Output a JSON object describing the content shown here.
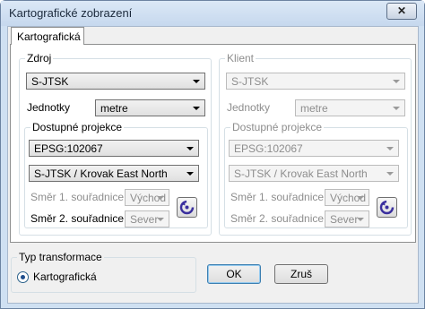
{
  "window": {
    "title": "Kartografické zobrazení",
    "close_glyph": "✕"
  },
  "tab": {
    "label": "Kartografická"
  },
  "source": {
    "group_label": "Zdroj",
    "system": "S-JTSK",
    "units_label": "Jednotky",
    "units_value": "metre",
    "projections": {
      "group_label": "Dostupné projekce",
      "epsg": "EPSG:102067",
      "name": "S-JTSK / Krovak East North",
      "axis1_label": "Směr 1. souřadnice",
      "axis1_value": "Východ",
      "axis2_label": "Směr 2. souřadnice",
      "axis2_value": "Sever"
    }
  },
  "client": {
    "group_label": "Klient",
    "system": "S-JTSK",
    "units_label": "Jednotky",
    "units_value": "metre",
    "projections": {
      "group_label": "Dostupné projekce",
      "epsg": "EPSG:102067",
      "name": "S-JTSK / Krovak East North",
      "axis1_label": "Směr 1. souřadnice",
      "axis1_value": "Východ",
      "axis2_label": "Směr 2. souřadnice",
      "axis2_value": "Sever"
    }
  },
  "transform": {
    "group_label": "Typ transformace",
    "option": "Kartografická"
  },
  "buttons": {
    "ok": "OK",
    "cancel": "Zruš"
  },
  "icons": {
    "swap_axes": "rotate-icon",
    "accent": "#3a2f9e"
  }
}
